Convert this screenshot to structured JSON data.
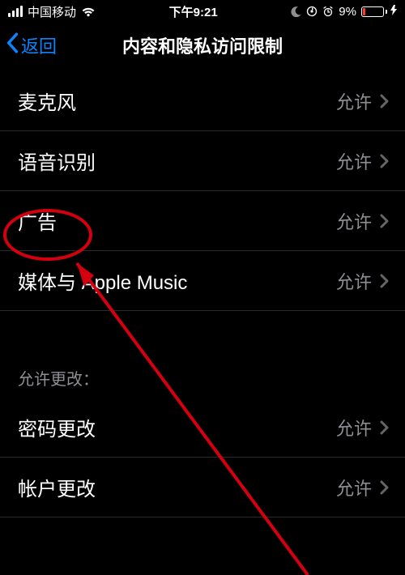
{
  "statusBar": {
    "carrier": "中国移动",
    "time": "下午9:21",
    "batteryPercent": "9%"
  },
  "nav": {
    "back": "返回",
    "title": "内容和隐私访问限制"
  },
  "rows": {
    "microphone": {
      "label": "麦克风",
      "value": "允许"
    },
    "speech": {
      "label": "语音识别",
      "value": "允许"
    },
    "ads": {
      "label": "广告",
      "value": "允许"
    },
    "media": {
      "label": "媒体与 Apple Music",
      "value": "允许"
    },
    "passcode": {
      "label": "密码更改",
      "value": "允许"
    },
    "account": {
      "label": "帐户更改",
      "value": "允许"
    }
  },
  "sectionHeader": "允许更改：",
  "annotation": {
    "target": "ads"
  }
}
